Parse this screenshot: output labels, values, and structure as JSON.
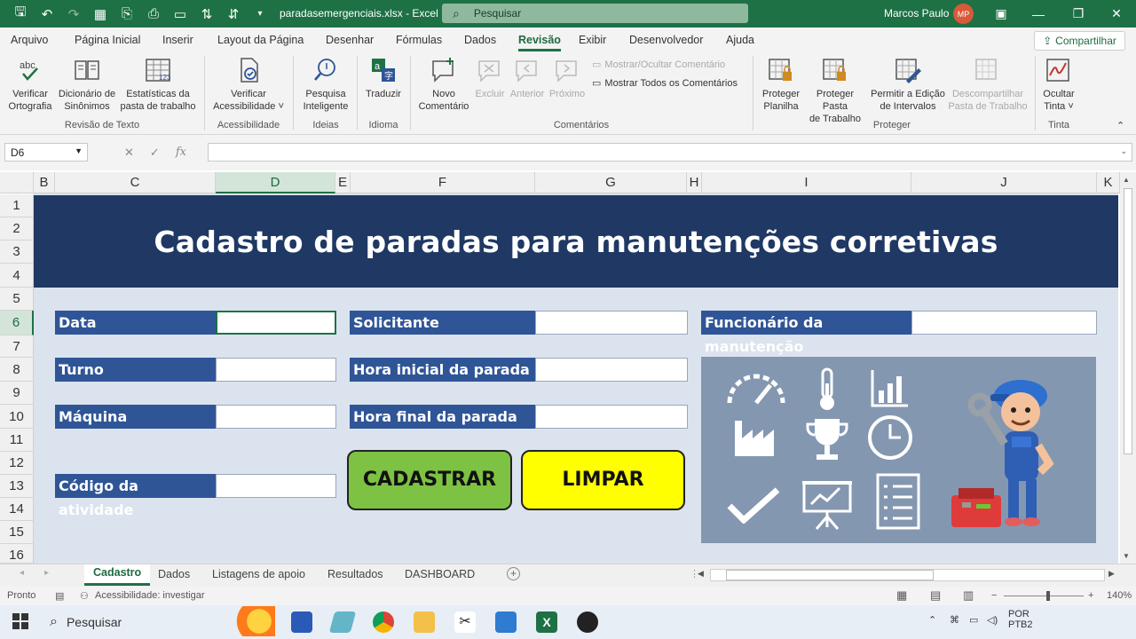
{
  "window": {
    "doc_title": "paradasemergenciais.xlsx  -  Excel",
    "search_placeholder": "Pesquisar",
    "user_name": "Marcos Paulo",
    "user_initials": "MP"
  },
  "menu": {
    "tabs": [
      "Arquivo",
      "Página Inicial",
      "Inserir",
      "Layout da Página",
      "Desenhar",
      "Fórmulas",
      "Dados",
      "Revisão",
      "Exibir",
      "Desenvolvedor",
      "Ajuda"
    ],
    "active_tab": "Revisão",
    "share_label": "Compartilhar"
  },
  "ribbon": {
    "groups": [
      {
        "label": "Revisão de Texto",
        "buttons": [
          {
            "line1": "Verificar",
            "line2": "Ortografia",
            "icon": "spellcheck-icon"
          },
          {
            "line1": "Dicionário de",
            "line2": "Sinônimos",
            "icon": "thesaurus-icon"
          },
          {
            "line1": "Estatísticas da",
            "line2": "pasta de trabalho",
            "icon": "workbook-statistics-icon"
          }
        ]
      },
      {
        "label": "Acessibilidade",
        "buttons": [
          {
            "line1": "Verificar",
            "line2": "Acessibilidade ˅",
            "icon": "accessibility-icon"
          }
        ]
      },
      {
        "label": "Ideias",
        "buttons": [
          {
            "line1": "Pesquisa",
            "line2": "Inteligente",
            "icon": "smart-lookup-icon"
          }
        ]
      },
      {
        "label": "Idioma",
        "buttons": [
          {
            "line1": "Traduzir",
            "line2": "",
            "icon": "translate-icon"
          }
        ]
      },
      {
        "label": "Comentários",
        "buttons": [
          {
            "line1": "Novo",
            "line2": "Comentário",
            "icon": "new-comment-icon"
          },
          {
            "line1": "Excluir",
            "line2": "",
            "icon": "delete-comment-icon"
          },
          {
            "line1": "Anterior",
            "line2": "",
            "icon": "previous-comment-icon"
          },
          {
            "line1": "Próximo",
            "line2": "",
            "icon": "next-comment-icon"
          }
        ],
        "small": [
          "Mostrar/Ocultar Comentário",
          "Mostrar Todos os Comentários"
        ]
      },
      {
        "label": "Proteger",
        "buttons": [
          {
            "line1": "Proteger",
            "line2": "Planilha",
            "icon": "protect-sheet-icon"
          },
          {
            "line1": "Proteger Pasta",
            "line2": "de Trabalho",
            "icon": "protect-workbook-icon"
          },
          {
            "line1": "Permitir a Edição",
            "line2": "de Intervalos",
            "icon": "allow-edit-ranges-icon"
          },
          {
            "line1": "Descompartilhar",
            "line2": "Pasta de Trabalho",
            "icon": "unshare-workbook-icon"
          }
        ]
      },
      {
        "label": "Tinta",
        "buttons": [
          {
            "line1": "Ocultar",
            "line2": "Tinta ˅",
            "icon": "hide-ink-icon"
          }
        ]
      }
    ]
  },
  "formula_bar": {
    "name_box": "D6",
    "cancel": "✕",
    "enter": "✓",
    "fx": "fx",
    "value": ""
  },
  "grid": {
    "columns": [
      "B",
      "C",
      "D",
      "E",
      "F",
      "G",
      "H",
      "I",
      "J",
      "K"
    ],
    "rows": [
      "1",
      "2",
      "3",
      "4",
      "5",
      "6",
      "7",
      "8",
      "9",
      "10",
      "11",
      "12",
      "13",
      "14",
      "15",
      "16"
    ],
    "selected_column": "D",
    "selected_row": "6"
  },
  "form": {
    "title": "Cadastro de paradas para manutenções corretivas",
    "labels": {
      "data": "Data",
      "turno": "Turno",
      "maquina": "Máquina",
      "codigo": "Código da atividade",
      "solicitante": "Solicitante",
      "hora_inicial": "Hora inicial da parada",
      "hora_final": "Hora final da parada",
      "funcionario": "Funcionário da manutenção"
    },
    "buttons": {
      "cadastrar": "CADASTRAR",
      "limpar": "LIMPAR"
    },
    "colors": {
      "banner": "#1f3864",
      "label": "#2f5597",
      "cadastrar": "#7dc242",
      "limpar": "#ffff00",
      "panel": "#8497b0"
    }
  },
  "sheet_tabs": {
    "tabs": [
      "Cadastro",
      "Dados",
      "Listagens de apoio",
      "Resultados",
      "DASHBOARD"
    ],
    "active": "Cadastro"
  },
  "status": {
    "ready": "Pronto",
    "accessibility": "Acessibilidade: investigar",
    "zoom": "140%"
  },
  "taskbar": {
    "search": "Pesquisar",
    "lang1": "POR",
    "lang2": "PTB2"
  }
}
